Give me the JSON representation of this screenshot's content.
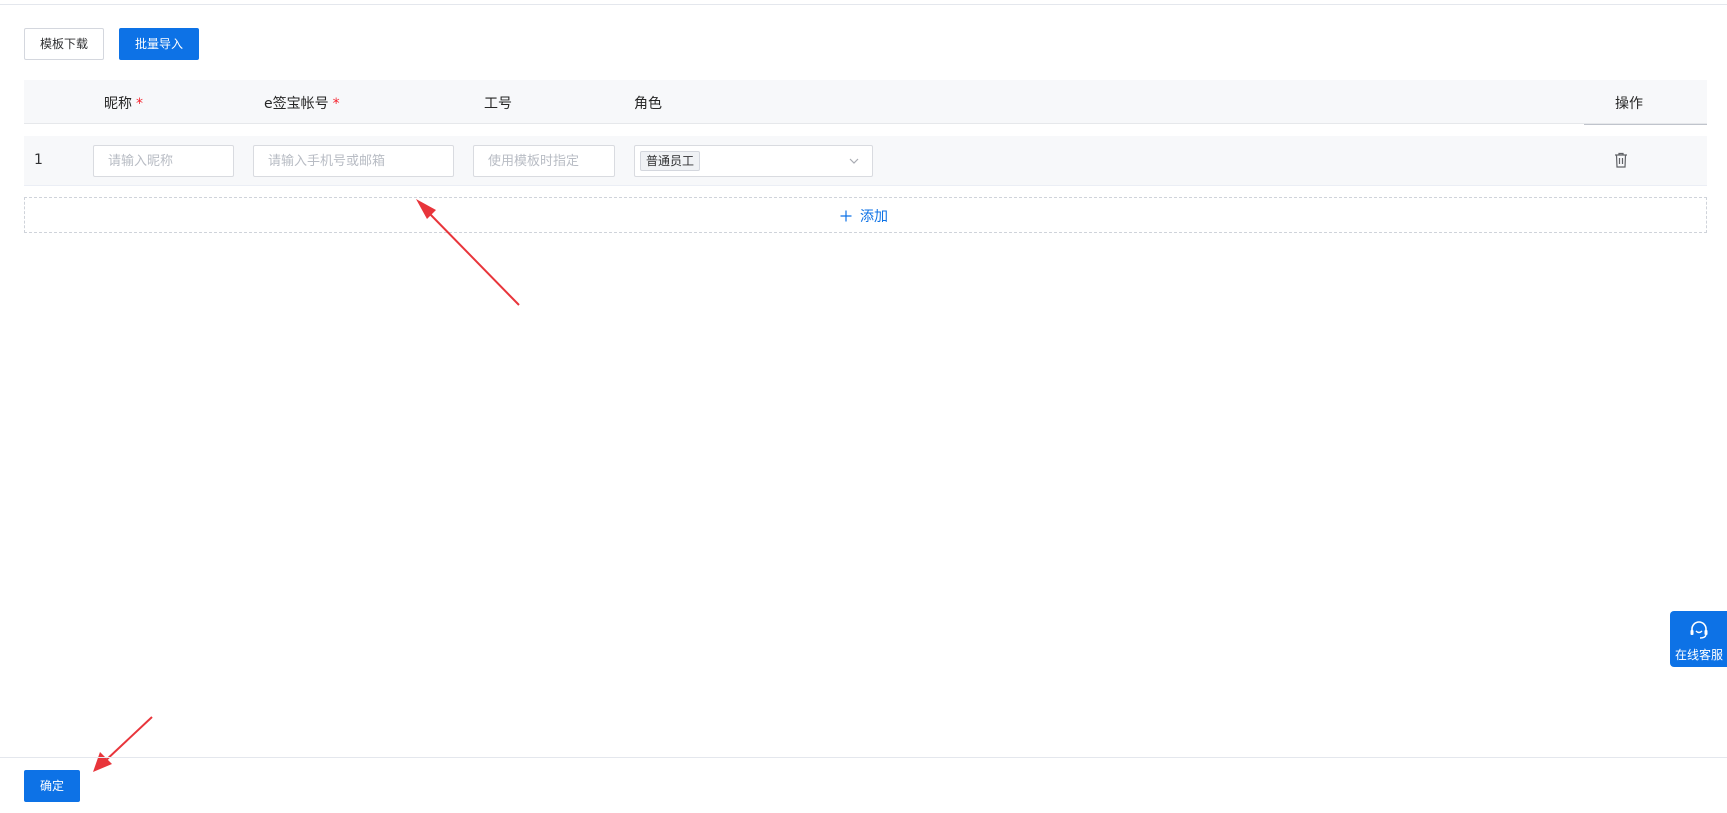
{
  "toolbar": {
    "template_download_label": "模板下载",
    "batch_import_label": "批量导入"
  },
  "table": {
    "columns": {
      "nickname": "昵称",
      "account": "e签宝帐号",
      "employee_no": "工号",
      "role": "角色",
      "actions": "操作"
    },
    "required_mark": "*",
    "rows": [
      {
        "index": "1",
        "nickname_placeholder": "请输入昵称",
        "account_placeholder": "请输入手机号或邮箱",
        "employee_no_placeholder": "使用模板时指定",
        "role_value": "普通员工"
      }
    ],
    "add_label": "添加"
  },
  "widget": {
    "service_label": "在线客服"
  },
  "footer": {
    "confirm_label": "确定"
  },
  "colors": {
    "primary": "#0d72e6",
    "required": "#f5222d",
    "annotation_arrow": "#e8353b"
  },
  "icons": {
    "trash": "trash-icon",
    "chevron": "chevron-down-icon",
    "plus": "plus-icon",
    "headset": "headset-icon"
  }
}
